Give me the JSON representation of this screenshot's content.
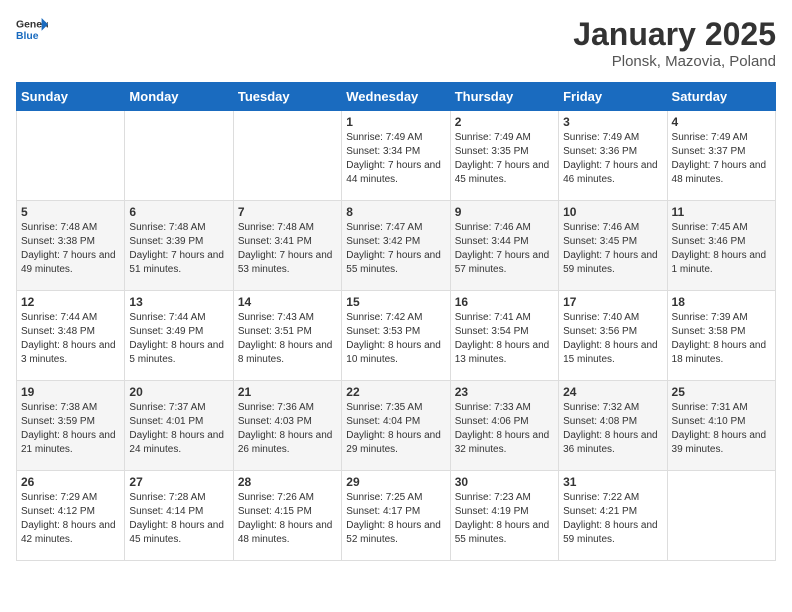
{
  "header": {
    "logo_general": "General",
    "logo_blue": "Blue",
    "title": "January 2025",
    "subtitle": "Plonsk, Mazovia, Poland"
  },
  "days_of_week": [
    "Sunday",
    "Monday",
    "Tuesday",
    "Wednesday",
    "Thursday",
    "Friday",
    "Saturday"
  ],
  "weeks": [
    [
      {
        "day": "",
        "info": ""
      },
      {
        "day": "",
        "info": ""
      },
      {
        "day": "",
        "info": ""
      },
      {
        "day": "1",
        "info": "Sunrise: 7:49 AM\nSunset: 3:34 PM\nDaylight: 7 hours and 44 minutes."
      },
      {
        "day": "2",
        "info": "Sunrise: 7:49 AM\nSunset: 3:35 PM\nDaylight: 7 hours and 45 minutes."
      },
      {
        "day": "3",
        "info": "Sunrise: 7:49 AM\nSunset: 3:36 PM\nDaylight: 7 hours and 46 minutes."
      },
      {
        "day": "4",
        "info": "Sunrise: 7:49 AM\nSunset: 3:37 PM\nDaylight: 7 hours and 48 minutes."
      }
    ],
    [
      {
        "day": "5",
        "info": "Sunrise: 7:48 AM\nSunset: 3:38 PM\nDaylight: 7 hours and 49 minutes."
      },
      {
        "day": "6",
        "info": "Sunrise: 7:48 AM\nSunset: 3:39 PM\nDaylight: 7 hours and 51 minutes."
      },
      {
        "day": "7",
        "info": "Sunrise: 7:48 AM\nSunset: 3:41 PM\nDaylight: 7 hours and 53 minutes."
      },
      {
        "day": "8",
        "info": "Sunrise: 7:47 AM\nSunset: 3:42 PM\nDaylight: 7 hours and 55 minutes."
      },
      {
        "day": "9",
        "info": "Sunrise: 7:46 AM\nSunset: 3:44 PM\nDaylight: 7 hours and 57 minutes."
      },
      {
        "day": "10",
        "info": "Sunrise: 7:46 AM\nSunset: 3:45 PM\nDaylight: 7 hours and 59 minutes."
      },
      {
        "day": "11",
        "info": "Sunrise: 7:45 AM\nSunset: 3:46 PM\nDaylight: 8 hours and 1 minute."
      }
    ],
    [
      {
        "day": "12",
        "info": "Sunrise: 7:44 AM\nSunset: 3:48 PM\nDaylight: 8 hours and 3 minutes."
      },
      {
        "day": "13",
        "info": "Sunrise: 7:44 AM\nSunset: 3:49 PM\nDaylight: 8 hours and 5 minutes."
      },
      {
        "day": "14",
        "info": "Sunrise: 7:43 AM\nSunset: 3:51 PM\nDaylight: 8 hours and 8 minutes."
      },
      {
        "day": "15",
        "info": "Sunrise: 7:42 AM\nSunset: 3:53 PM\nDaylight: 8 hours and 10 minutes."
      },
      {
        "day": "16",
        "info": "Sunrise: 7:41 AM\nSunset: 3:54 PM\nDaylight: 8 hours and 13 minutes."
      },
      {
        "day": "17",
        "info": "Sunrise: 7:40 AM\nSunset: 3:56 PM\nDaylight: 8 hours and 15 minutes."
      },
      {
        "day": "18",
        "info": "Sunrise: 7:39 AM\nSunset: 3:58 PM\nDaylight: 8 hours and 18 minutes."
      }
    ],
    [
      {
        "day": "19",
        "info": "Sunrise: 7:38 AM\nSunset: 3:59 PM\nDaylight: 8 hours and 21 minutes."
      },
      {
        "day": "20",
        "info": "Sunrise: 7:37 AM\nSunset: 4:01 PM\nDaylight: 8 hours and 24 minutes."
      },
      {
        "day": "21",
        "info": "Sunrise: 7:36 AM\nSunset: 4:03 PM\nDaylight: 8 hours and 26 minutes."
      },
      {
        "day": "22",
        "info": "Sunrise: 7:35 AM\nSunset: 4:04 PM\nDaylight: 8 hours and 29 minutes."
      },
      {
        "day": "23",
        "info": "Sunrise: 7:33 AM\nSunset: 4:06 PM\nDaylight: 8 hours and 32 minutes."
      },
      {
        "day": "24",
        "info": "Sunrise: 7:32 AM\nSunset: 4:08 PM\nDaylight: 8 hours and 36 minutes."
      },
      {
        "day": "25",
        "info": "Sunrise: 7:31 AM\nSunset: 4:10 PM\nDaylight: 8 hours and 39 minutes."
      }
    ],
    [
      {
        "day": "26",
        "info": "Sunrise: 7:29 AM\nSunset: 4:12 PM\nDaylight: 8 hours and 42 minutes."
      },
      {
        "day": "27",
        "info": "Sunrise: 7:28 AM\nSunset: 4:14 PM\nDaylight: 8 hours and 45 minutes."
      },
      {
        "day": "28",
        "info": "Sunrise: 7:26 AM\nSunset: 4:15 PM\nDaylight: 8 hours and 48 minutes."
      },
      {
        "day": "29",
        "info": "Sunrise: 7:25 AM\nSunset: 4:17 PM\nDaylight: 8 hours and 52 minutes."
      },
      {
        "day": "30",
        "info": "Sunrise: 7:23 AM\nSunset: 4:19 PM\nDaylight: 8 hours and 55 minutes."
      },
      {
        "day": "31",
        "info": "Sunrise: 7:22 AM\nSunset: 4:21 PM\nDaylight: 8 hours and 59 minutes."
      },
      {
        "day": "",
        "info": ""
      }
    ]
  ]
}
